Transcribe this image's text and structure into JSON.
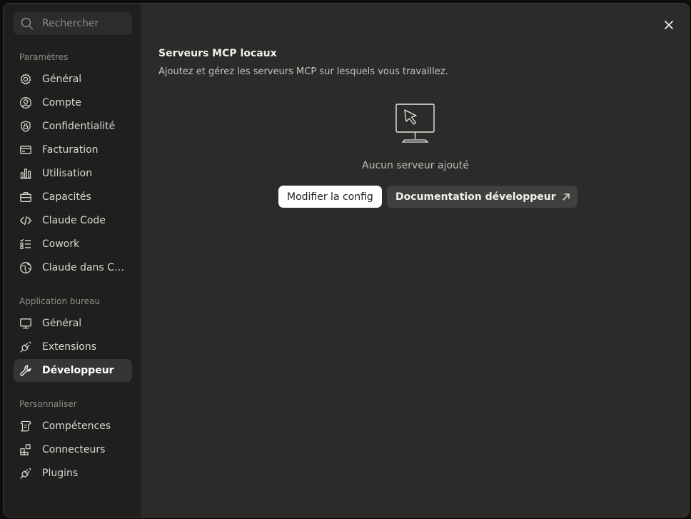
{
  "search": {
    "placeholder": "Rechercher"
  },
  "sidebar": {
    "sections": [
      {
        "title": "Paramètres",
        "items": [
          {
            "label": "Général",
            "icon": "gear-icon"
          },
          {
            "label": "Compte",
            "icon": "user-circle-icon"
          },
          {
            "label": "Confidentialité",
            "icon": "shield-lock-icon"
          },
          {
            "label": "Facturation",
            "icon": "credit-card-icon"
          },
          {
            "label": "Utilisation",
            "icon": "bar-chart-icon"
          },
          {
            "label": "Capacités",
            "icon": "briefcase-icon"
          },
          {
            "label": "Claude Code",
            "icon": "code-icon"
          },
          {
            "label": "Cowork",
            "icon": "checklist-icon"
          },
          {
            "label": "Claude dans Ch…",
            "icon": "globe-icon"
          }
        ]
      },
      {
        "title": "Application bureau",
        "items": [
          {
            "label": "Général",
            "icon": "monitor-icon"
          },
          {
            "label": "Extensions",
            "icon": "plug-icon"
          },
          {
            "label": "Développeur",
            "icon": "wrench-icon",
            "active": true
          }
        ]
      },
      {
        "title": "Personnaliser",
        "items": [
          {
            "label": "Compétences",
            "icon": "scroll-icon"
          },
          {
            "label": "Connecteurs",
            "icon": "blocks-icon"
          },
          {
            "label": "Plugins",
            "icon": "plug-icon"
          }
        ]
      }
    ]
  },
  "main": {
    "title": "Serveurs MCP locaux",
    "subtitle": "Ajoutez et gérez les serveurs MCP sur lesquels vous travaillez.",
    "empty_text": "Aucun serveur ajouté",
    "edit_config_label": "Modifier la config",
    "docs_label": "Documentation développeur"
  },
  "colors": {
    "background": "#2b2b2a",
    "sidebar": "#1f1f1e",
    "active_item": "#353533",
    "primary_button": "#ffffff",
    "secondary_button": "#40403e"
  }
}
